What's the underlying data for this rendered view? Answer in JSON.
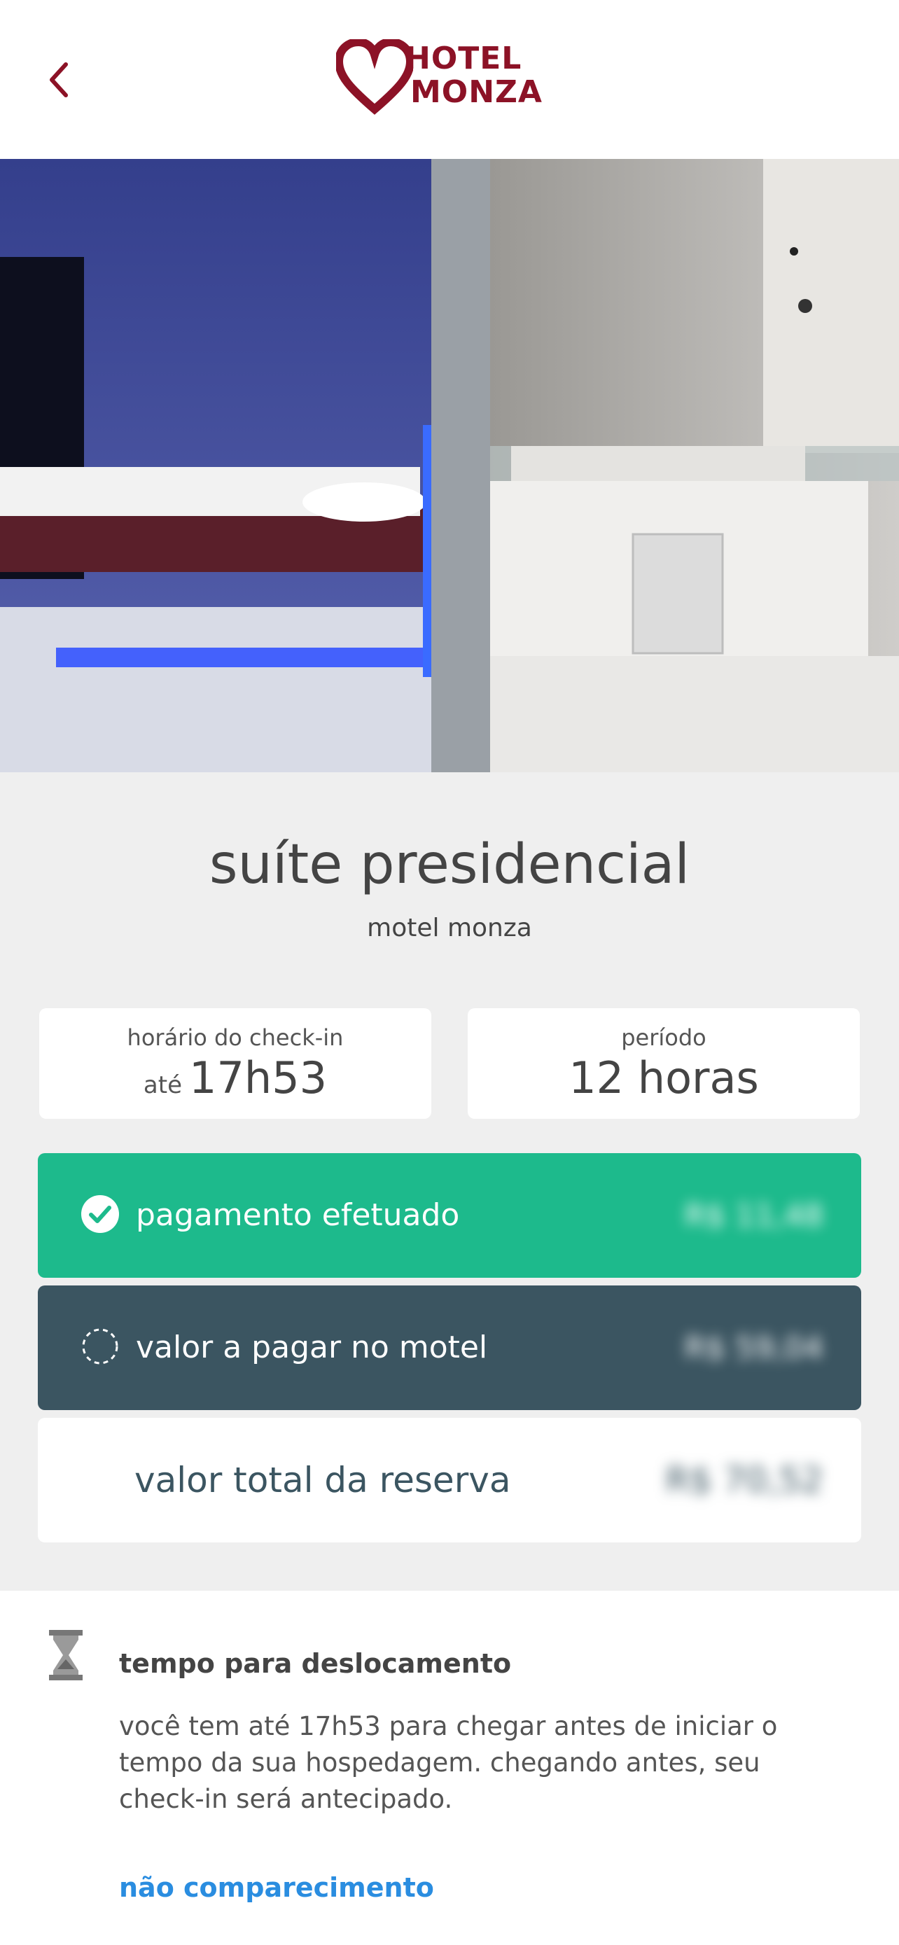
{
  "header": {
    "logo_line1": "HOTEL",
    "logo_line2": "MONZA",
    "brand_color": "#8c1226"
  },
  "suite": {
    "name": "suíte presidencial",
    "motel": "motel monza"
  },
  "checkin": {
    "label": "horário do check-in",
    "prefix": "até",
    "time": "17h53"
  },
  "period": {
    "label": "período",
    "value": "12 horas"
  },
  "payment": {
    "paid_label": "pagamento efetuado",
    "paid_amount": "R$ 11,48",
    "due_label": "valor a pagar no motel",
    "due_amount": "R$ 59,04",
    "total_label": "valor total da reserva",
    "total_amount": "R$ 70,52"
  },
  "travel": {
    "title": "tempo para deslocamento",
    "text": "você tem até 17h53 para chegar antes de iniciar o tempo da sua hospedagem. chegando antes, seu check-in será antecipado.",
    "link": "não comparecimento"
  },
  "colors": {
    "paid_bg": "#1dba8c",
    "due_bg": "#3b5561",
    "link": "#2a8de0"
  },
  "icons": [
    "chevron-left-icon",
    "hotel-logo",
    "check-circle-icon",
    "dashed-circle-icon",
    "hourglass-icon"
  ]
}
